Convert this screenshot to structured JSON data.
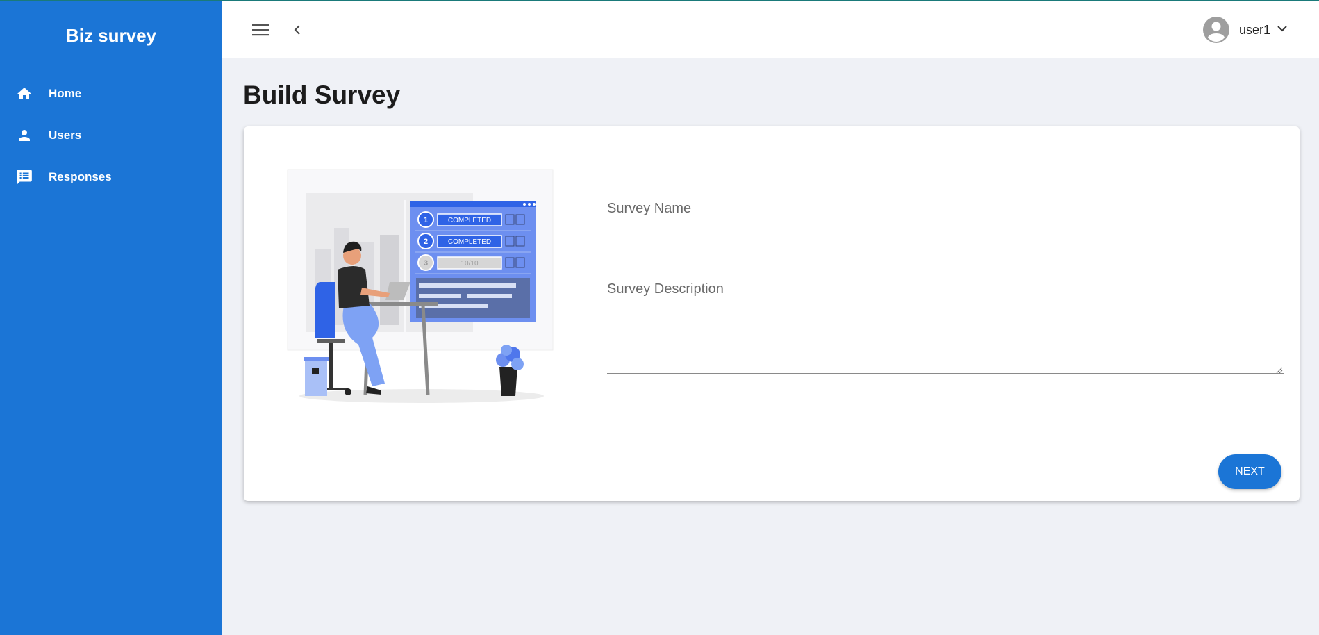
{
  "app": {
    "brand": "Biz survey"
  },
  "sidebar": {
    "items": [
      {
        "label": "Home",
        "icon": "home-icon"
      },
      {
        "label": "Users",
        "icon": "person-icon"
      },
      {
        "label": "Responses",
        "icon": "feedback-icon"
      }
    ]
  },
  "topbar": {
    "username": "user1"
  },
  "page": {
    "title": "Build Survey"
  },
  "form": {
    "name_placeholder": "Survey Name",
    "description_placeholder": "Survey Description",
    "next_label": "NEXT"
  },
  "illustration": {
    "steps": [
      {
        "number": "1",
        "status": "COMPLETED"
      },
      {
        "number": "2",
        "status": "COMPLETED"
      },
      {
        "number": "3",
        "status": "10/10"
      }
    ]
  },
  "colors": {
    "accent": "#1b75d6",
    "background": "#eff1f6",
    "topline": "#1a7a7a"
  }
}
